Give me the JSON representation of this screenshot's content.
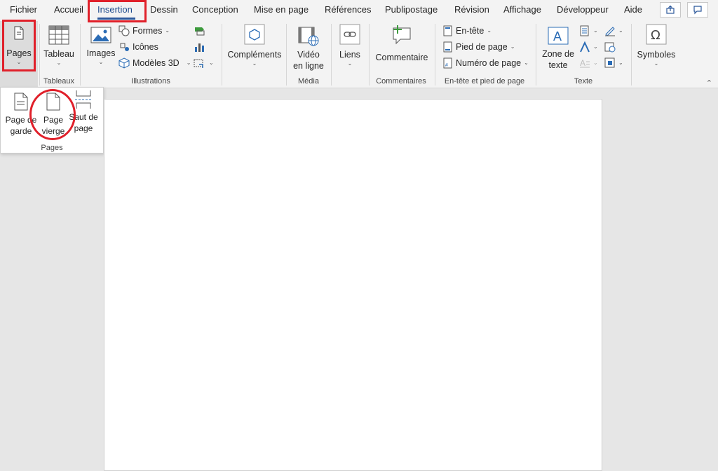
{
  "tabs": [
    {
      "label": "Fichier"
    },
    {
      "label": "Accueil"
    },
    {
      "label": "Insertion"
    },
    {
      "label": "Dessin"
    },
    {
      "label": "Conception"
    },
    {
      "label": "Mise en page"
    },
    {
      "label": "Références"
    },
    {
      "label": "Publipostage"
    },
    {
      "label": "Révision"
    },
    {
      "label": "Affichage"
    },
    {
      "label": "Développeur"
    },
    {
      "label": "Aide"
    }
  ],
  "active_tab": "Insertion",
  "ribbon": {
    "pages": {
      "label": "Pages"
    },
    "tableaux": {
      "button": "Tableau",
      "group": "Tableaux"
    },
    "illustrations": {
      "images": "Images",
      "formes": "Formes",
      "icones": "Icônes",
      "modeles3d": "Modèles 3D",
      "group": "Illustrations"
    },
    "complements": {
      "label": "Compléments"
    },
    "media": {
      "line1": "Vidéo",
      "line2": "en ligne",
      "group": "Média"
    },
    "liens": {
      "label": "Liens"
    },
    "commentaires": {
      "label": "Commentaire",
      "group": "Commentaires"
    },
    "entete": {
      "entete": "En-tête",
      "pied": "Pied de page",
      "numero": "Numéro de page",
      "group": "En-tête et pied de page"
    },
    "texte": {
      "line1": "Zone de",
      "line2": "texte",
      "group": "Texte"
    },
    "symboles": {
      "label": "Symboles"
    }
  },
  "dropdown": {
    "items": [
      {
        "line1": "Page de",
        "line2": "garde"
      },
      {
        "line1": "Page",
        "line2": "vierge"
      },
      {
        "line1": "Saut de",
        "line2": "page"
      }
    ],
    "group": "Pages"
  },
  "colors": {
    "accent": "#2b579a",
    "annotation": "#e0202a",
    "ribbon_bg": "#f3f3f3",
    "canvas_bg": "#e6e6e6"
  }
}
